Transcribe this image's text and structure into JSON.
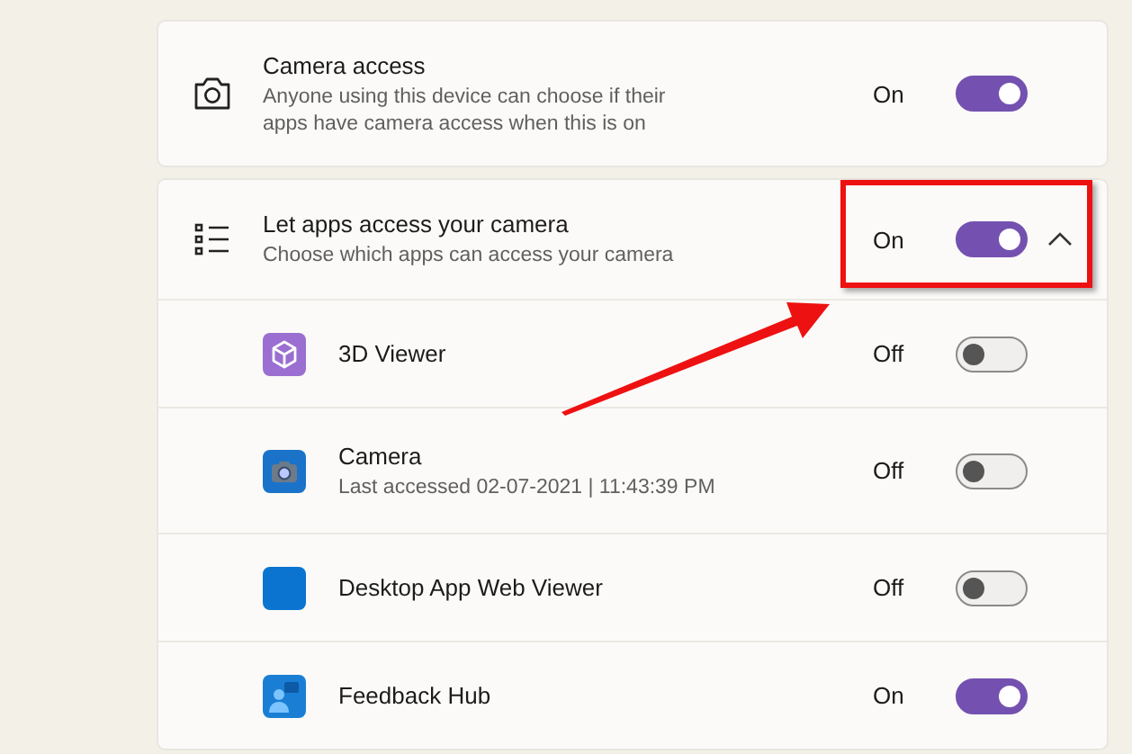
{
  "camera_access": {
    "title": "Camera access",
    "description": "Anyone using this device can choose if their apps have camera access when this is on",
    "state_label": "On",
    "on": true
  },
  "app_access": {
    "title": "Let apps access your camera",
    "description": "Choose which apps can access your camera",
    "state_label": "On",
    "on": true,
    "expanded": true
  },
  "apps": [
    {
      "kind": "cube",
      "name": "3D Viewer",
      "state_label": "Off",
      "on": false
    },
    {
      "kind": "camera",
      "name": "Camera",
      "detail": "Last accessed 02-07-2021  |  11:43:39 PM",
      "state_label": "Off",
      "on": false
    },
    {
      "kind": "tile",
      "name": "Desktop App Web Viewer",
      "state_label": "Off",
      "on": false
    },
    {
      "kind": "feedback",
      "name": "Feedback Hub",
      "state_label": "On",
      "on": true
    }
  ]
}
